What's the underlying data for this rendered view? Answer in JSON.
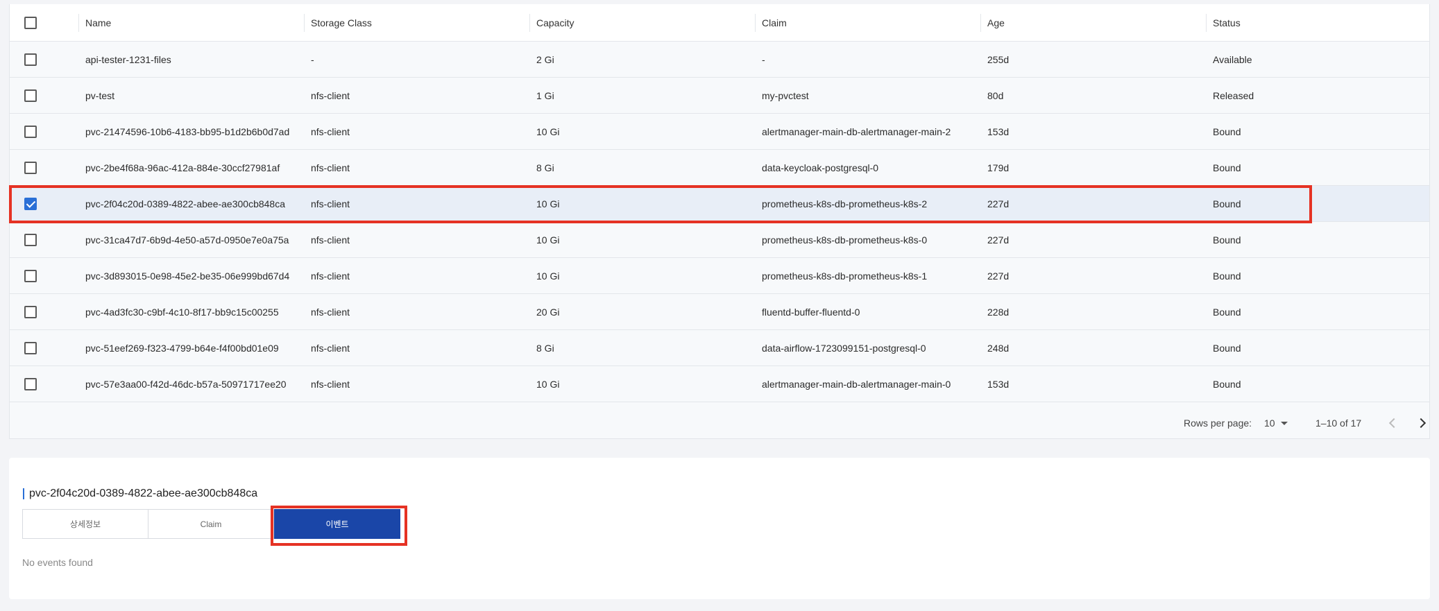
{
  "table": {
    "columns": [
      "Name",
      "Storage Class",
      "Capacity",
      "Claim",
      "Age",
      "Status"
    ],
    "rows": [
      {
        "name": "api-tester-1231-files",
        "storage_class": "-",
        "capacity": "2 Gi",
        "claim": "-",
        "age": "255d",
        "status": "Available",
        "checked": false
      },
      {
        "name": "pv-test",
        "storage_class": "nfs-client",
        "capacity": "1 Gi",
        "claim": "my-pvctest",
        "age": "80d",
        "status": "Released",
        "checked": false
      },
      {
        "name": "pvc-21474596-10b6-4183-bb95-b1d2b6b0d7ad",
        "storage_class": "nfs-client",
        "capacity": "10 Gi",
        "claim": "alertmanager-main-db-alertmanager-main-2",
        "age": "153d",
        "status": "Bound",
        "checked": false
      },
      {
        "name": "pvc-2be4f68a-96ac-412a-884e-30ccf27981af",
        "storage_class": "nfs-client",
        "capacity": "8 Gi",
        "claim": "data-keycloak-postgresql-0",
        "age": "179d",
        "status": "Bound",
        "checked": false
      },
      {
        "name": "pvc-2f04c20d-0389-4822-abee-ae300cb848ca",
        "storage_class": "nfs-client",
        "capacity": "10 Gi",
        "claim": "prometheus-k8s-db-prometheus-k8s-2",
        "age": "227d",
        "status": "Bound",
        "checked": true
      },
      {
        "name": "pvc-31ca47d7-6b9d-4e50-a57d-0950e7e0a75a",
        "storage_class": "nfs-client",
        "capacity": "10 Gi",
        "claim": "prometheus-k8s-db-prometheus-k8s-0",
        "age": "227d",
        "status": "Bound",
        "checked": false
      },
      {
        "name": "pvc-3d893015-0e98-45e2-be35-06e999bd67d4",
        "storage_class": "nfs-client",
        "capacity": "10 Gi",
        "claim": "prometheus-k8s-db-prometheus-k8s-1",
        "age": "227d",
        "status": "Bound",
        "checked": false
      },
      {
        "name": "pvc-4ad3fc30-c9bf-4c10-8f17-bb9c15c00255",
        "storage_class": "nfs-client",
        "capacity": "20 Gi",
        "claim": "fluentd-buffer-fluentd-0",
        "age": "228d",
        "status": "Bound",
        "checked": false
      },
      {
        "name": "pvc-51eef269-f323-4799-b64e-f4f00bd01e09",
        "storage_class": "nfs-client",
        "capacity": "8 Gi",
        "claim": "data-airflow-1723099151-postgresql-0",
        "age": "248d",
        "status": "Bound",
        "checked": false
      },
      {
        "name": "pvc-57e3aa00-f42d-46dc-b57a-50971717ee20",
        "storage_class": "nfs-client",
        "capacity": "10 Gi",
        "claim": "alertmanager-main-db-alertmanager-main-0",
        "age": "153d",
        "status": "Bound",
        "checked": false
      }
    ]
  },
  "pagination": {
    "rows_per_page_label": "Rows per page:",
    "rows_per_page_value": "10",
    "range_text": "1–10 of 17"
  },
  "detail": {
    "title": "pvc-2f04c20d-0389-4822-abee-ae300cb848ca",
    "tabs": [
      "상세정보",
      "Claim",
      "이벤트"
    ],
    "active_tab": "이벤트",
    "empty_text": "No events found"
  },
  "colors": {
    "selected_checkbox": "#2a6fd6",
    "active_tab": "#1a46a8",
    "highlight": "#e53224"
  }
}
